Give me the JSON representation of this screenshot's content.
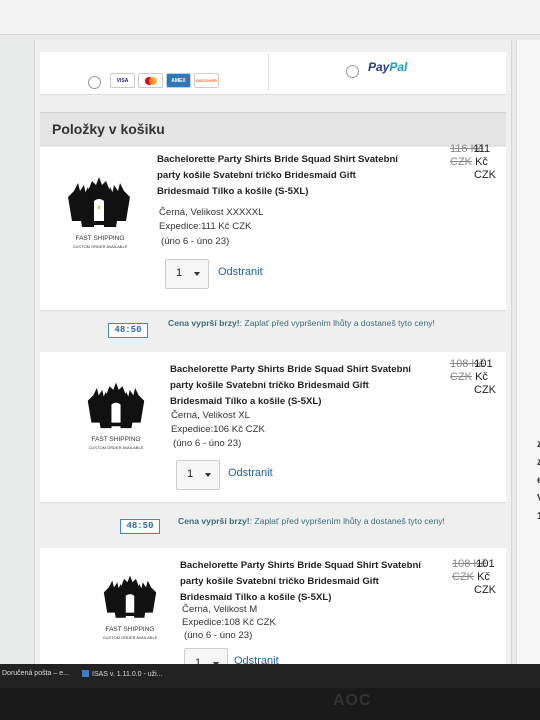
{
  "payment": {
    "cards": [
      "VISA",
      "MC",
      "AMEX",
      "DISCOVER"
    ],
    "paypal_part1": "Pay",
    "paypal_part2": "Pal"
  },
  "cart": {
    "title": "Položky v košiku"
  },
  "items": [
    {
      "title_line1": "Bachelorette Party Shirts Bride Squad Shirt Svatební",
      "title_line2": "party košile Svatební tričko Bridesmaid Gift",
      "title_line3": "Bridesmaid Tílko a košile   (S-5XL)",
      "variant": "Černá, Velikost XXXXXL",
      "shipping": "Expedice:111 Kč CZK",
      "dates": "(úno 6 - úno 23)",
      "old_price_a": "116 Kč",
      "old_price_b": "CZK",
      "new_price_a": "111",
      "new_price_b": "Kč",
      "new_price_c": "CZK",
      "qty": "1",
      "remove": "Odstranit"
    },
    {
      "title_line1": "Bachelorette Party Shirts Bride Squad Shirt Svatební",
      "title_line2": "party košile Svatební tričko Bridesmaid Gift",
      "title_line3": "Bridesmaid Tílko a košile   (S-5XL)",
      "variant": "Černá, Velikost XL",
      "shipping": "Expedice:106 Kč CZK",
      "dates": "(úno 6 - úno 23)",
      "old_price_a": "108 Kč",
      "old_price_b": "CZK",
      "new_price_a": "101",
      "new_price_b": "Kč",
      "new_price_c": "CZK",
      "qty": "1",
      "remove": "Odstranit"
    },
    {
      "title_line1": "Bachelorette Party Shirts Bride Squad Shirt Svatební",
      "title_line2": "party košile Svatební tričko Bridesmaid Gift",
      "title_line3": "Bridesmaid Tílko a košile   (S-5XL)",
      "variant": "Černá, Velikost M",
      "shipping": "Expedice:108 Kč CZK",
      "dates": "(úno 6 - úno 23)",
      "old_price_a": "108 Kč",
      "old_price_b": "CZK",
      "new_price_a": "101",
      "new_price_b": "Kč",
      "new_price_c": "CZK",
      "qty": "1",
      "remove": "Odstranit"
    }
  ],
  "timer": {
    "time": "48:50",
    "bold_text": "Cena vyprší brzy!",
    "text": ": Zaplať před vypršením lhůty a dostaneš tyto ceny!"
  },
  "thumb": {
    "caption1": "FAST SHIPPING",
    "caption2": "CUSTOM ORDER AVAILABLE"
  },
  "taskbar": {
    "item1": "Doručená pošta – e...",
    "item2": "ISAS v. 1.11.0.0 - uži..."
  },
  "bezel": {
    "logo": "AOC"
  },
  "right_panel": {
    "letters": [
      "z",
      "z",
      "e",
      "V",
      "1"
    ]
  },
  "colors": {
    "link": "#1a62b0",
    "timer_border": "#4a84c3",
    "timer_text": "#3a6d78"
  }
}
